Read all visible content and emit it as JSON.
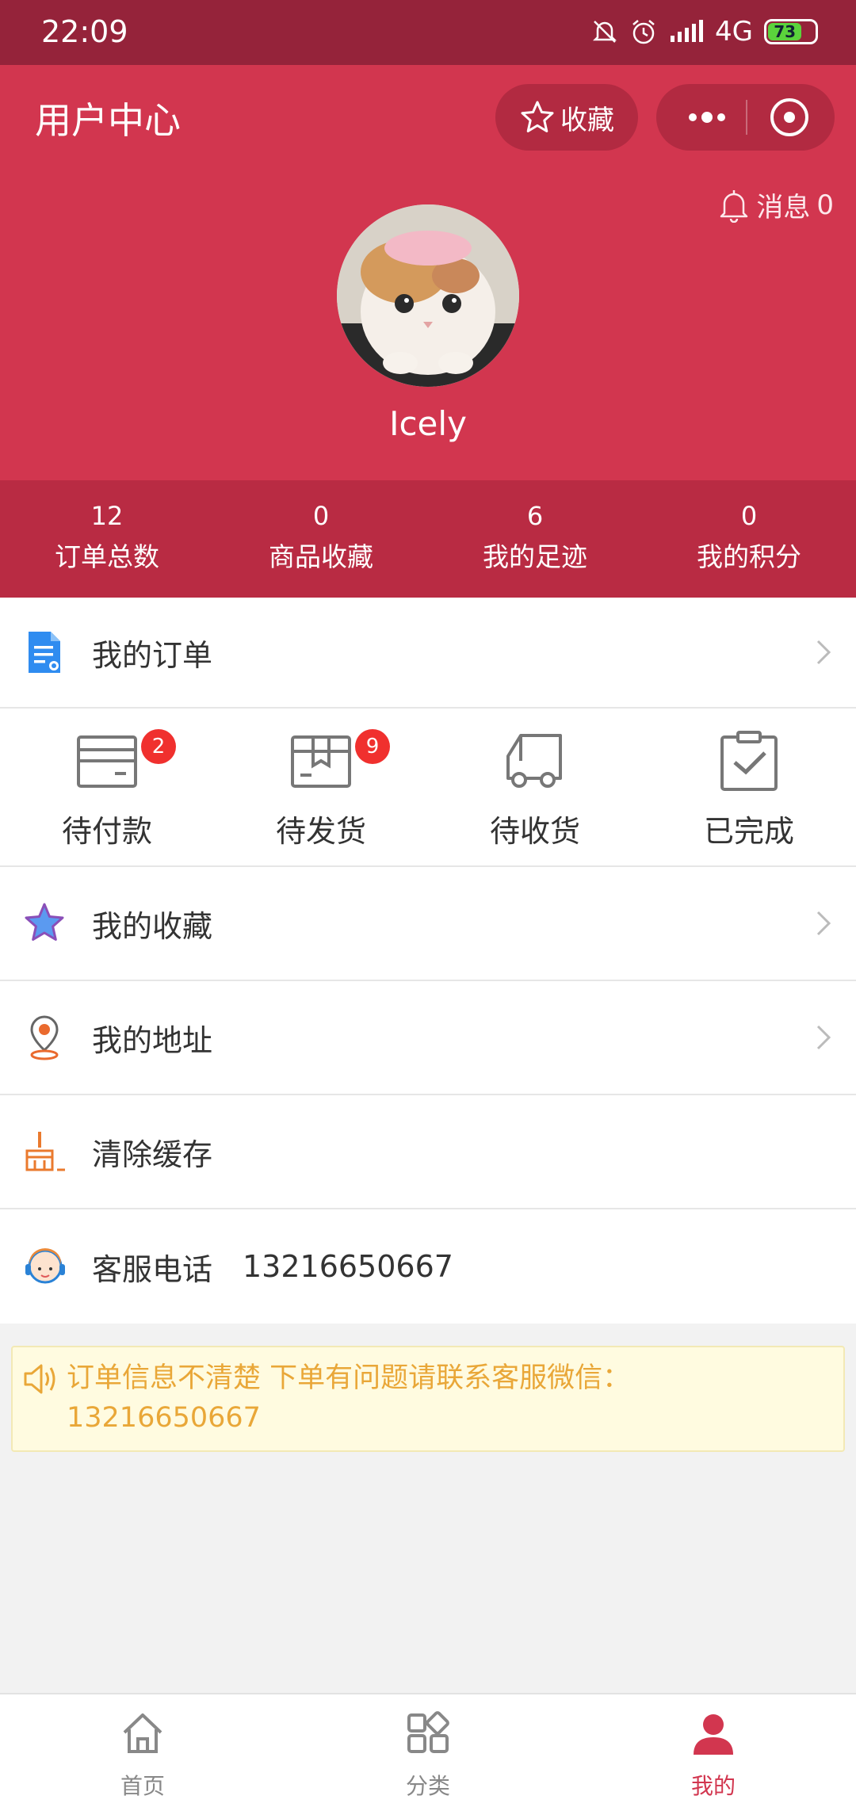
{
  "status_bar": {
    "time": "22:09",
    "network": "4G",
    "battery": "73"
  },
  "header": {
    "title": "用户中心",
    "favorite_label": "收藏",
    "messages_label": "消息",
    "messages_count": "0",
    "username": "Icely"
  },
  "stats": [
    {
      "value": "12",
      "label": "订单总数"
    },
    {
      "value": "0",
      "label": "商品收藏"
    },
    {
      "value": "6",
      "label": "我的足迹"
    },
    {
      "value": "0",
      "label": "我的积分"
    }
  ],
  "my_orders": {
    "label": "我的订单"
  },
  "order_status": [
    {
      "label": "待付款",
      "badge": "2"
    },
    {
      "label": "待发货",
      "badge": "9"
    },
    {
      "label": "待收货"
    },
    {
      "label": "已完成"
    }
  ],
  "menu": {
    "favorites": "我的收藏",
    "address": "我的地址",
    "clear_cache": "清除缓存",
    "service_phone_label": "客服电话",
    "service_phone": "13216650667"
  },
  "notice": {
    "text": "订单信息不清楚 下单有问题请联系客服微信：13216650667"
  },
  "tabbar": [
    {
      "label": "首页",
      "icon": "home-icon"
    },
    {
      "label": "分类",
      "icon": "category-icon"
    },
    {
      "label": "我的",
      "icon": "user-icon",
      "active": true
    }
  ],
  "colors": {
    "primary": "#d2364f",
    "status_bar": "#95233a",
    "stats_bar": "#b92b43",
    "notice_text": "#e9a738",
    "badge": "#f0302e"
  }
}
